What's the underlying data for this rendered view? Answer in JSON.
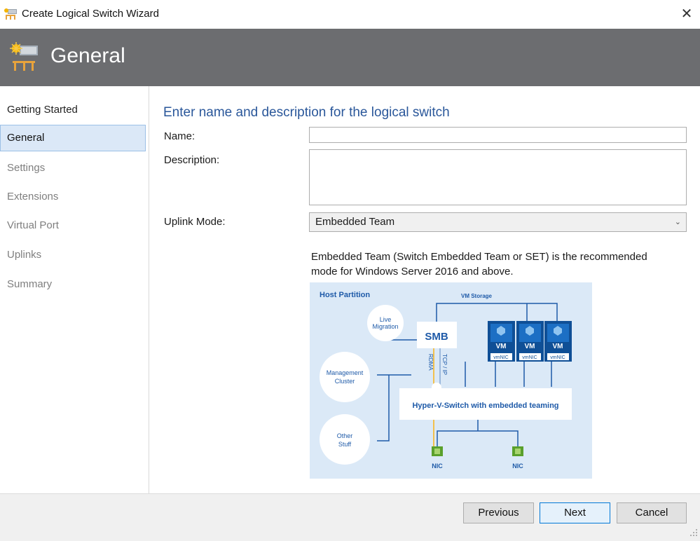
{
  "window": {
    "title": "Create Logical Switch Wizard",
    "close_icon": "close-icon",
    "app_icon": "logical-switch-icon"
  },
  "banner": {
    "title": "General",
    "icon": "logical-switch-icon"
  },
  "sidebar": {
    "items": [
      {
        "label": "Getting Started",
        "state": "done"
      },
      {
        "label": "General",
        "state": "active"
      },
      {
        "label": "Settings",
        "state": "pending"
      },
      {
        "label": "Extensions",
        "state": "pending"
      },
      {
        "label": "Virtual Port",
        "state": "pending"
      },
      {
        "label": "Uplinks",
        "state": "pending"
      },
      {
        "label": "Summary",
        "state": "pending"
      }
    ]
  },
  "main": {
    "section_title": "Enter name and description for the logical switch",
    "name_label": "Name:",
    "name_value": "",
    "description_label": "Description:",
    "description_value": "",
    "uplink_mode_label": "Uplink Mode:",
    "uplink_mode_value": "Embedded Team",
    "info_text": "Embedded Team (Switch Embedded Team or SET) is the recommended mode for Windows Server 2016 and above."
  },
  "diagram": {
    "host_partition": "Host Partition",
    "vm_storage": "VM Storage",
    "live_migration_1": "Live",
    "live_migration_2": "Migration",
    "smb": "SMB",
    "rdma": "RDMA",
    "tcp_ip": "TCP / IP",
    "management_1": "Management",
    "management_2": "Cluster",
    "other_1": "Other",
    "other_2": "Stuff",
    "vm_label": "VM",
    "vmnic_label": "vmNIC",
    "switch_label": "Hyper-V-Switch with embedded teaming",
    "nic_label": "NIC"
  },
  "footer": {
    "previous": "Previous",
    "next": "Next",
    "cancel": "Cancel"
  },
  "colors": {
    "banner": "#6c6d70",
    "accent": "#2a579a",
    "active_nav": "#dbe8f7",
    "diagram_bg": "#dbe9f7",
    "diagram_blue": "#0f4f96"
  }
}
